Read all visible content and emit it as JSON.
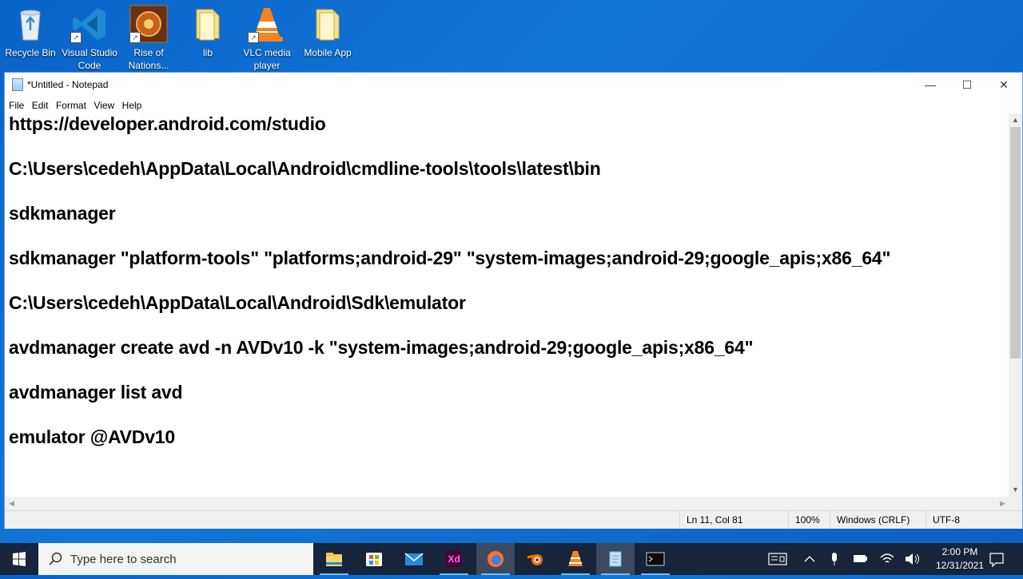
{
  "desktop": {
    "icons": [
      {
        "label": "Recycle Bin",
        "icon": "recycle-bin-icon"
      },
      {
        "label": "Visual Studio Code",
        "icon": "vscode-icon"
      },
      {
        "label": "Rise of Nations...",
        "icon": "rise-of-nations-icon"
      },
      {
        "label": "lib",
        "icon": "folder-icon"
      },
      {
        "label": "VLC media player",
        "icon": "vlc-icon"
      },
      {
        "label": "Mobile App",
        "icon": "folder-icon"
      }
    ]
  },
  "window": {
    "title": "*Untitled - Notepad",
    "menu": [
      "File",
      "Edit",
      "Format",
      "View",
      "Help"
    ],
    "lines": [
      "https://developer.android.com/studio",
      "C:\\Users\\cedeh\\AppData\\Local\\Android\\cmdline-tools\\tools\\latest\\bin",
      "sdkmanager",
      "sdkmanager \"platform-tools\" \"platforms;android-29\" \"system-images;android-29;google_apis;x86_64\"",
      "C:\\Users\\cedeh\\AppData\\Local\\Android\\Sdk\\emulator",
      "avdmanager create avd -n AVDv10 -k \"system-images;android-29;google_apis;x86_64\"",
      "avdmanager list avd",
      "emulator @AVDv10"
    ],
    "status": {
      "position": "Ln 11, Col 81",
      "zoom": "100%",
      "line_ending": "Windows (CRLF)",
      "encoding": "UTF-8"
    }
  },
  "taskbar": {
    "search_placeholder": "Type here to search",
    "apps": [
      "file-explorer-icon",
      "microsoft-store-icon",
      "mail-icon",
      "adobe-xd-icon",
      "firefox-icon",
      "blender-icon",
      "vlc-icon",
      "notepad-icon",
      "terminal-icon"
    ],
    "xd_label": "Xd",
    "time": "2:00 PM",
    "date": "12/31/2021"
  },
  "colors": {
    "desktop": "#0a63c9",
    "taskbar": "#16243c",
    "accent": "#76b9ed"
  }
}
